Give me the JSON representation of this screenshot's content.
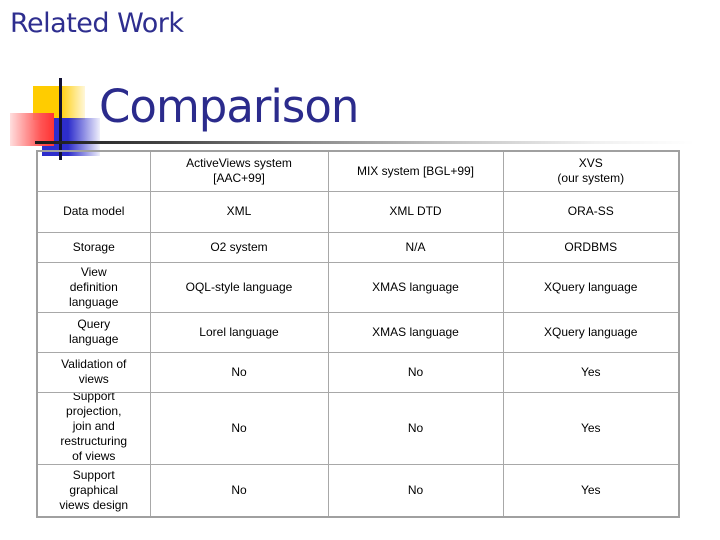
{
  "section_title": "Related Work",
  "slide_title": "Comparison",
  "colors": {
    "title": "#2b2b8c",
    "deco_yellow": "#ffcc00",
    "deco_blue": "#2d2dcc",
    "deco_red": "#ff3333",
    "table_border": "#a0a0a0"
  },
  "table": {
    "headers": [
      "",
      "ActiveViews system\n[AAC+99]",
      "MIX system [BGL+99]",
      "XVS\n(our system)"
    ],
    "rows": [
      {
        "feature": "Data model",
        "values": [
          "XML",
          "XML DTD",
          "ORA-SS"
        ]
      },
      {
        "feature": "Storage",
        "values": [
          "O2 system",
          "N/A",
          "ORDBMS"
        ]
      },
      {
        "feature": "View\ndefinition\nlanguage",
        "values": [
          "OQL-style language",
          "XMAS language",
          "XQuery language"
        ]
      },
      {
        "feature": "Query\nlanguage",
        "values": [
          "Lorel language",
          "XMAS language",
          "XQuery language"
        ]
      },
      {
        "feature": "Validation of\nviews",
        "values": [
          "No",
          "No",
          "Yes"
        ]
      },
      {
        "feature": "Support\nprojection,\njoin and\nrestructuring\nof views",
        "values": [
          "No",
          "No",
          "Yes"
        ]
      },
      {
        "feature": "Support\ngraphical\nviews design",
        "values": [
          "No",
          "No",
          "Yes"
        ]
      }
    ]
  }
}
